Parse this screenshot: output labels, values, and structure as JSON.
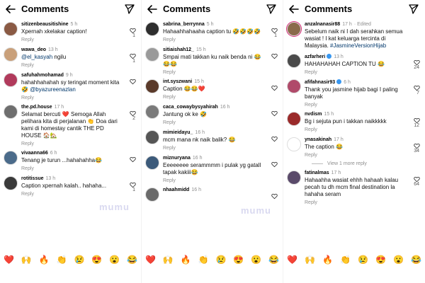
{
  "header": {
    "title": "Comments"
  },
  "watermark": "mumu",
  "emoji_bar": [
    "❤️",
    "🙌",
    "🔥",
    "👏",
    "😢",
    "😍",
    "😮",
    "😂"
  ],
  "panels": [
    {
      "comments": [
        {
          "user": "sitizenbeausitishine",
          "time": "5 h",
          "text": "Xpernah xkelakar caption!",
          "reply": "Reply",
          "likes": "1",
          "avatar": "#8a5a44"
        },
        {
          "user": "wawa_deo",
          "time": "13 h",
          "text_parts": [
            {
              "t": "@el_kasyah",
              "c": "mention"
            },
            {
              "t": " ngilu"
            }
          ],
          "reply": "Reply",
          "likes": "1",
          "avatar": "#c9a07a"
        },
        {
          "user": "safuhahmohamad",
          "time": "9 h",
          "text_parts": [
            {
              "t": "hahahhahahah sy teringat moment kita 🤣 "
            },
            {
              "t": "@byazureenazlan",
              "c": "mention"
            }
          ],
          "reply": "Reply",
          "likes": "",
          "avatar": "#b13a5c"
        },
        {
          "user": "the.pd.house",
          "time": "17 h",
          "text": "Selamat bercuti ❤️ Semoga Allah pelihara kita di perjalanan 👏 Doa dari kami di homestay cantik THE PD HOUSE 🏠🏡",
          "reply": "Reply",
          "likes": "2",
          "avatar": "#6e6e6e"
        },
        {
          "user": "vivaanna66",
          "time": "6 h",
          "text": "Tenang je turun ...hahahahha😂",
          "reply": "Reply",
          "likes": "",
          "avatar": "#4b6b8a"
        },
        {
          "user": "rotitissue",
          "time": "13 h",
          "text": "Caption xpernah kalah.. hahaha...",
          "reply": "Reply",
          "likes": "1",
          "avatar": "#3a3a3a"
        }
      ]
    },
    {
      "comments": [
        {
          "user": "sabrina_berrynna",
          "time": "5 h",
          "text": "Hahaahhahaaha caption tu 🤣🤣🤣🤣",
          "reply": "Reply",
          "likes": "1",
          "avatar": "#2e2e2e"
        },
        {
          "user": "sitiaishah12_",
          "time": "15 h",
          "text": "Smpai mati takkan ku naik benda ni 😂 😂😂",
          "reply": "Reply",
          "likes": "",
          "avatar": "#9a9a9a"
        },
        {
          "user": "int.syszwani",
          "time": "15 h",
          "text": "Caption 😂😂❤️",
          "reply": "Reply",
          "likes": "",
          "avatar": "#5a3a2a"
        },
        {
          "user": "caca_cowaybysyahirah",
          "time": "16 h",
          "text": "Jantung ok ke 🤣",
          "reply": "Reply",
          "likes": "",
          "avatar": "#7a7a7a"
        },
        {
          "user": "mimieidayu_",
          "time": "16 h",
          "text": "mcm mana nk naik balik? 😂",
          "reply": "Reply",
          "likes": "",
          "avatar": "#555555"
        },
        {
          "user": "miznuryana",
          "time": "16 h",
          "text": "Eeeeeeee serammmm i pulak yg gatall tapak kakiii😂",
          "reply": "Reply",
          "likes": "",
          "avatar": "#3c5a7a"
        },
        {
          "user": "nhaahmidd",
          "time": "16 h",
          "text": "",
          "reply": "",
          "likes": "",
          "avatar": "#6a6a6a"
        }
      ]
    },
    {
      "comments": [
        {
          "user": "anzalnanasir88",
          "time": "17 h",
          "edited": "· Edited",
          "text_parts": [
            {
              "t": "Sebelum naik ni I dah serahkan semua wasiat ! I kat keluarga tercinta di Malaysia. "
            },
            {
              "t": "#JasmineVersionHijab",
              "c": "tag"
            }
          ],
          "reply": "",
          "likes": "",
          "avatar": "#8a6a4a"
        },
        {
          "user": "azfarheri",
          "time": "13 h",
          "verified": true,
          "text": "HAHAHAHAH CAPTION TU 😂",
          "reply": "Reply",
          "likes": "24",
          "avatar": "#4a4a4a"
        },
        {
          "user": "afifahnasir93",
          "time": "6 h",
          "verified": true,
          "text": "Thank you jasmine hijab bagi I paling banyak",
          "reply": "Reply",
          "likes": "7",
          "avatar": "#b04a6a"
        },
        {
          "user": "nvdism",
          "time": "15 h",
          "text": "Bg i sejuta pun i takkan naikkkkk",
          "reply": "Reply",
          "likes": "12",
          "avatar": "#9a2a2a"
        },
        {
          "user": "ynasakinah",
          "time": "17 h",
          "text": "The caption 😂",
          "reply": "Reply",
          "likes": "34",
          "avatar": "#ffffff"
        },
        {
          "view_more": "View 1 more reply"
        },
        {
          "user": "fatinalmas",
          "time": "17 h",
          "text": "Hahaahha wasiat ehhh hahaah kalau pecah tu dh mcm final destination la hahaha seram",
          "reply": "Reply",
          "likes": "64",
          "avatar": "#5a4a6a"
        }
      ]
    }
  ]
}
